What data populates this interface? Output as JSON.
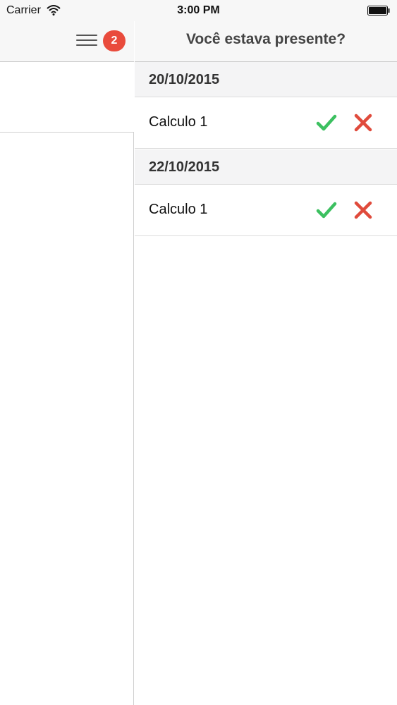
{
  "status_bar": {
    "carrier": "Carrier",
    "time": "3:00 PM"
  },
  "left": {
    "badge_count": "2"
  },
  "navbar": {
    "title": "Você estava presente?"
  },
  "sections": [
    {
      "date": "20/10/2015",
      "rows": [
        {
          "label": "Calculo 1"
        }
      ]
    },
    {
      "date": "22/10/2015",
      "rows": [
        {
          "label": "Calculo 1"
        }
      ]
    }
  ],
  "colors": {
    "check": "#3cc060",
    "cross": "#e04b3c",
    "badge": "#e94b3c"
  },
  "icons": {
    "confirm": "checkmark-icon",
    "deny": "x-icon",
    "menu": "hamburger-icon",
    "wifi": "wifi-icon",
    "battery": "battery-icon"
  }
}
